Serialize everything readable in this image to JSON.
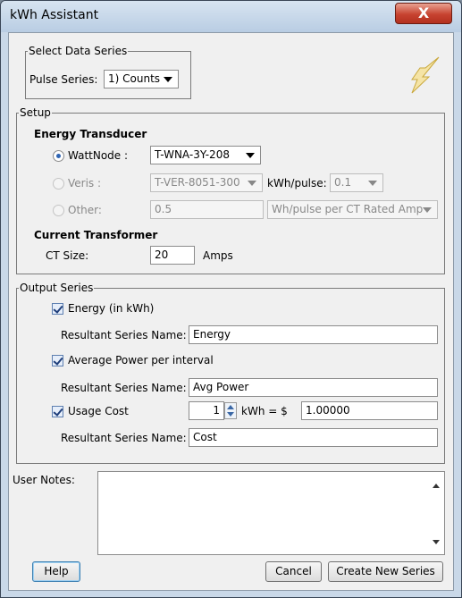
{
  "window": {
    "title": "kWh Assistant",
    "close_label": "X"
  },
  "select_data_series": {
    "legend": "Select Data Series",
    "pulse_series_label": "Pulse Series:",
    "pulse_series_value": "1) Counts"
  },
  "setup": {
    "legend": "Setup",
    "energy_transducer_heading": "Energy Transducer",
    "wattnode": {
      "label": "WattNode :",
      "value": "T-WNA-3Y-208",
      "selected": true
    },
    "veris": {
      "label": "Veris :",
      "value": "T-VER-8051-300",
      "kwh_pulse_label": "kWh/pulse:",
      "kwh_pulse_value": "0.1"
    },
    "other": {
      "label": "Other:",
      "value": "0.5",
      "unit_value": "Wh/pulse per CT Rated Amp"
    },
    "current_transformer_heading": "Current Transformer",
    "ct_size_label": "CT Size:",
    "ct_size_value": "20",
    "ct_unit": "Amps"
  },
  "output_series": {
    "legend": "Output Series",
    "energy": {
      "label": "Energy (in kWh)",
      "checked": true,
      "name_label": "Resultant Series Name:",
      "name_value": "Energy"
    },
    "avg_power": {
      "label": "Average Power per interval",
      "checked": true,
      "name_label": "Resultant Series Name:",
      "name_value": "Avg Power"
    },
    "usage_cost": {
      "label": "Usage Cost",
      "checked": true,
      "kwh_value": "1",
      "equals_label": "kWh = $",
      "rate_value": "1.00000",
      "name_label": "Resultant Series Name:",
      "name_value": "Cost"
    }
  },
  "user_notes": {
    "label": "User Notes:",
    "value": ""
  },
  "buttons": {
    "help": "Help",
    "cancel": "Cancel",
    "create": "Create New Series"
  },
  "colors": {
    "accent": "#2f65b4",
    "close": "#c74330",
    "frame": "#c9d8e8",
    "client": "#f0f0f0"
  }
}
